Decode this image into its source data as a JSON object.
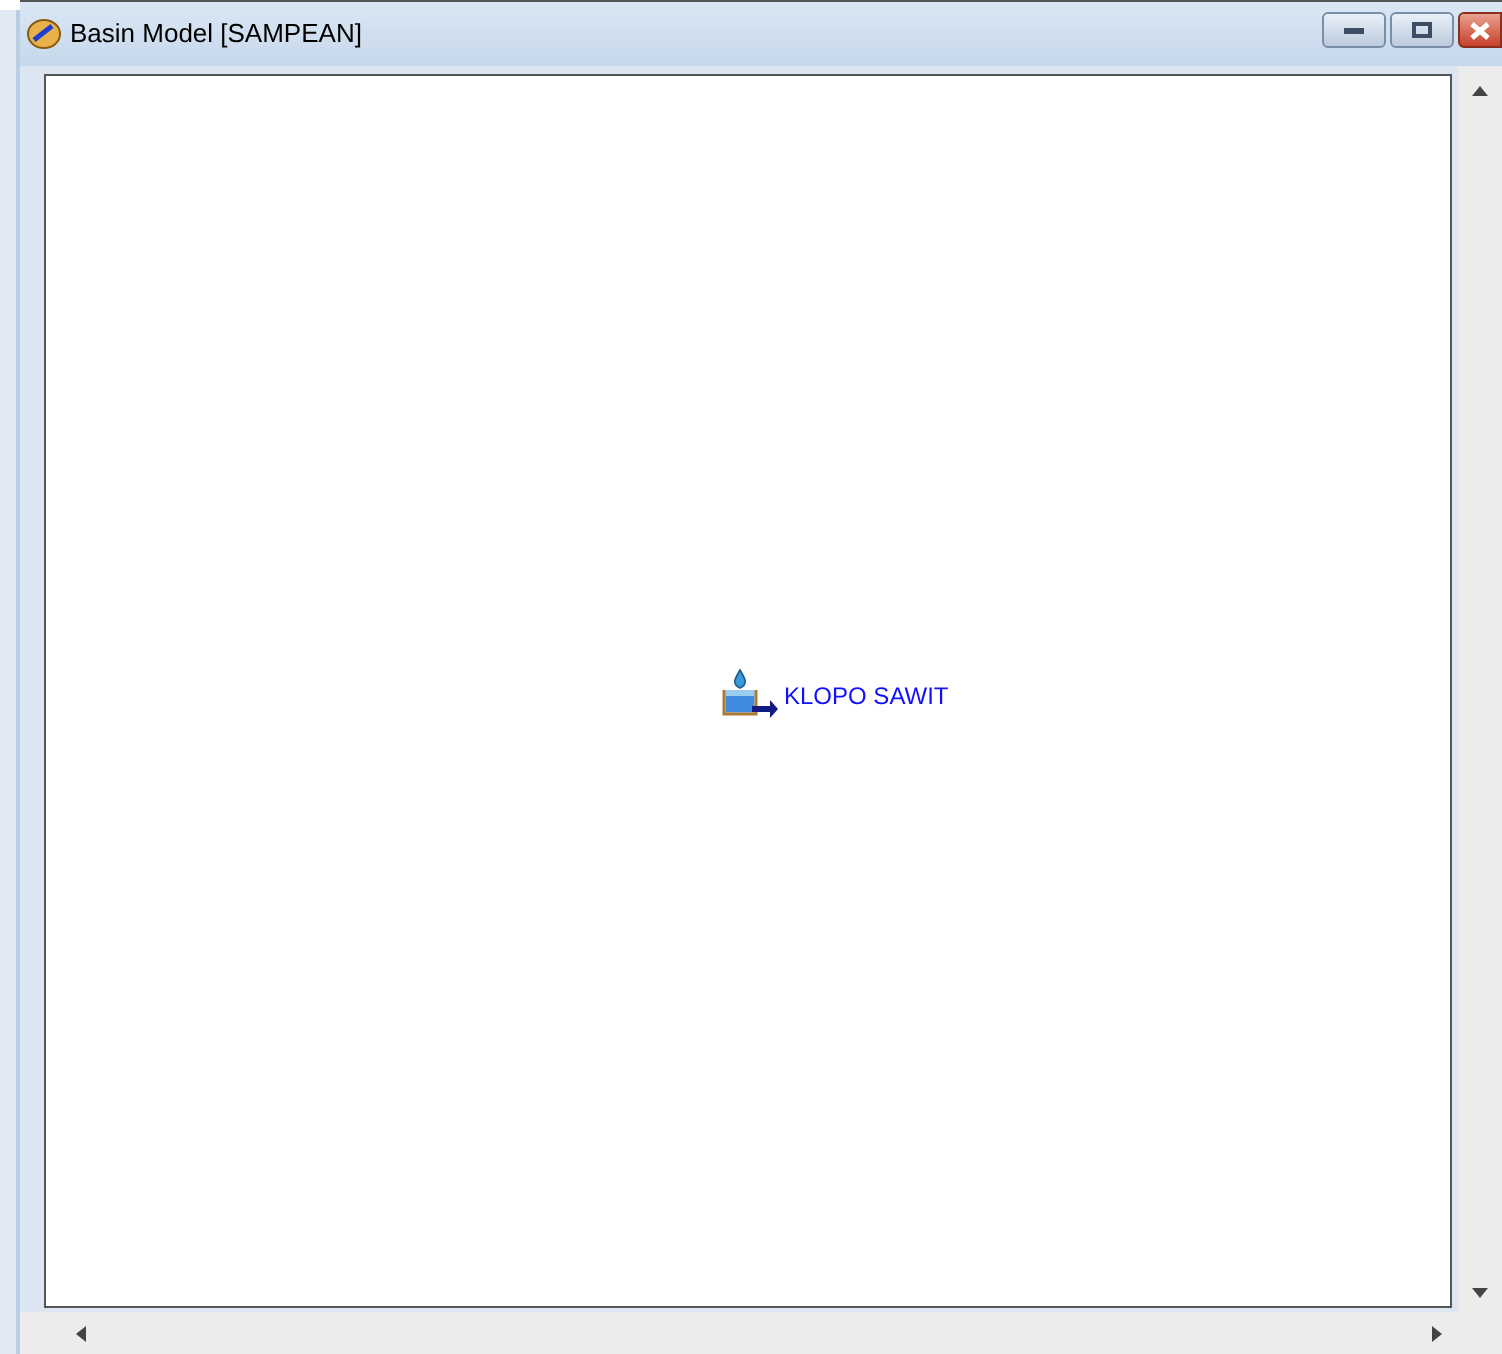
{
  "window": {
    "title": "Basin Model [SAMPEAN]"
  },
  "canvas": {
    "elements": [
      {
        "kind": "reservoir",
        "label": "KLOPO SAWIT"
      }
    ]
  }
}
